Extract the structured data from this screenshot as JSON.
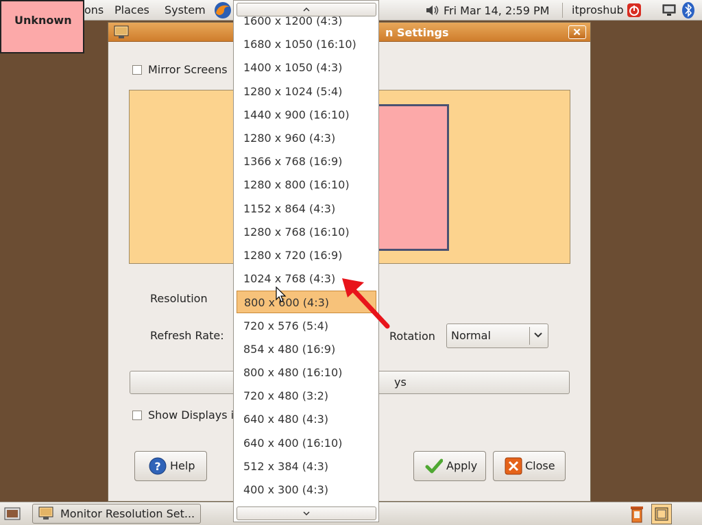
{
  "overlay_label": "Unknown",
  "top_panel": {
    "menus": [
      "ons",
      "Places",
      "System"
    ],
    "clock": "Fri Mar 14,  2:59 PM",
    "user": "itproshub",
    "icons": [
      "firefox-icon",
      "volume-icon",
      "power-icon",
      "network-icon",
      "bluetooth-icon"
    ]
  },
  "dialog": {
    "title": "n Settings",
    "mirror_screens_label": "Mirror Screens",
    "monitor_label_fragment": "n",
    "resolution_label": "Resolution",
    "refresh_rate_label": "Refresh Rate:",
    "rotation_label": "Rotation",
    "rotation_value": "Normal",
    "detect_button_fragment": "ys",
    "show_displays_label": "Show Displays i",
    "help_label": "Help",
    "apply_label": "Apply",
    "close_label": "Close"
  },
  "resolution_dropdown": {
    "selected_index": 12,
    "items": [
      "1600 x 1200 (4:3)",
      "1680 x 1050 (16:10)",
      "1400 x 1050 (4:3)",
      "1280 x 1024 (5:4)",
      "1440 x 900 (16:10)",
      "1280 x 960 (4:3)",
      "1366 x 768 (16:9)",
      "1280 x 800 (16:10)",
      "1152 x 864 (4:3)",
      "1280 x 768 (16:10)",
      "1280 x 720 (16:9)",
      "1024 x 768 (4:3)",
      "800 x 600 (4:3)",
      "720 x 576 (5:4)",
      "854 x 480 (16:9)",
      "800 x 480 (16:10)",
      "720 x 480 (3:2)",
      "640 x 480 (4:3)",
      "640 x 400 (16:10)",
      "512 x 384 (4:3)",
      "400 x 300 (4:3)"
    ]
  },
  "bottom_panel": {
    "task_label": "Monitor Resolution Set..."
  },
  "colors": {
    "title_bar": "#cf7d2c",
    "display_area": "#fcd38e",
    "monitor_box": "#fca9a9",
    "selection": "#f7c27a",
    "annotation_arrow": "#e8141b"
  }
}
